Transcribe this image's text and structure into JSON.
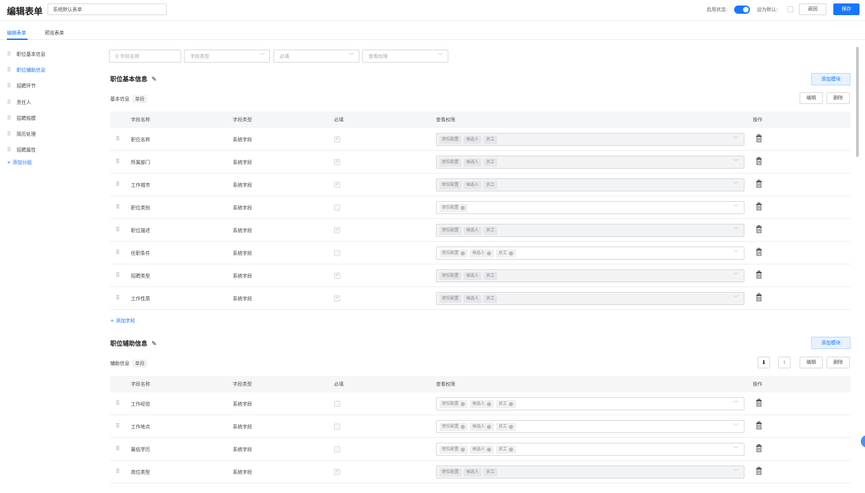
{
  "header": {
    "title": "编辑表单",
    "form_name": "系统默认表单",
    "enable_label": "启用状态:",
    "default_label": "设为默认:",
    "back_label": "返回",
    "save_label": "保存",
    "accent_color": "#1677ff"
  },
  "tabs": [
    {
      "label": "编辑表单",
      "active": true
    },
    {
      "label": "预览表单",
      "active": false
    }
  ],
  "sidebar": {
    "items": [
      {
        "label": "职位基本信息",
        "active": false
      },
      {
        "label": "职位辅助信息",
        "active": true
      },
      {
        "label": "招聘环节",
        "active": false
      },
      {
        "label": "责任人",
        "active": false
      },
      {
        "label": "招聘规模",
        "active": false
      },
      {
        "label": "简历处理",
        "active": false
      },
      {
        "label": "招聘属性",
        "active": false
      }
    ],
    "add_group": "+ 添加分组"
  },
  "filters": {
    "name_placeholder": "字段名称",
    "type_placeholder": "字段类型",
    "required_placeholder": "必填",
    "permission_placeholder": "查看权限"
  },
  "table_headers": {
    "name": "字段名称",
    "type": "字段类型",
    "required": "必填",
    "permission": "查看权限",
    "action": "操作"
  },
  "sections": [
    {
      "title": "职位基本信息",
      "add_module": "添加模块",
      "sub_label": "基本信息",
      "sub_badge": "单段",
      "edit": "编辑",
      "delete": "删除",
      "add_field": "+ 添加字段",
      "rows": [
        {
          "name": "职位名称",
          "type": "系统字段",
          "required": true,
          "disabled": true,
          "tags": [
            "职位配置",
            "候选人",
            "员工"
          ],
          "removable": false
        },
        {
          "name": "所属部门",
          "type": "系统字段",
          "required": true,
          "disabled": true,
          "tags": [
            "职位配置",
            "候选人",
            "员工"
          ],
          "removable": false
        },
        {
          "name": "工作城市",
          "type": "系统字段",
          "required": true,
          "disabled": true,
          "tags": [
            "职位配置",
            "候选人",
            "员工"
          ],
          "removable": false
        },
        {
          "name": "职位类别",
          "type": "系统字段",
          "required": false,
          "disabled": false,
          "tags": [
            "职位配置"
          ],
          "removable": true
        },
        {
          "name": "职位描述",
          "type": "系统字段",
          "required": true,
          "disabled": true,
          "tags": [
            "职位配置",
            "候选人",
            "员工"
          ],
          "removable": false
        },
        {
          "name": "任职条件",
          "type": "系统字段",
          "required": false,
          "disabled": false,
          "tags": [
            "职位配置",
            "候选人",
            "员工"
          ],
          "removable": true
        },
        {
          "name": "招聘类型",
          "type": "系统字段",
          "required": true,
          "disabled": true,
          "tags": [
            "职位配置",
            "候选人",
            "员工"
          ],
          "removable": false
        },
        {
          "name": "工作性质",
          "type": "系统字段",
          "required": true,
          "disabled": true,
          "tags": [
            "职位配置",
            "候选人",
            "员工"
          ],
          "removable": false
        }
      ]
    },
    {
      "title": "职位辅助信息",
      "add_module": "添加模块",
      "sub_label": "辅助信息",
      "sub_badge": "单段",
      "edit": "编辑",
      "delete": "删除",
      "rows": [
        {
          "name": "工作经验",
          "type": "系统字段",
          "required": false,
          "disabled": false,
          "tags": [
            "职位配置",
            "候选人",
            "员工"
          ],
          "removable": true
        },
        {
          "name": "工作地点",
          "type": "系统字段",
          "required": false,
          "disabled": false,
          "tags": [
            "职位配置",
            "候选人",
            "员工"
          ],
          "removable": true
        },
        {
          "name": "最低学历",
          "type": "系统字段",
          "required": false,
          "disabled": false,
          "tags": [
            "职位配置",
            "候选人",
            "员工"
          ],
          "removable": true
        },
        {
          "name": "岗位类型",
          "type": "系统字段",
          "required": true,
          "disabled": true,
          "tags": [
            "职位配置",
            "候选人",
            "员工"
          ],
          "removable": false
        }
      ]
    }
  ]
}
